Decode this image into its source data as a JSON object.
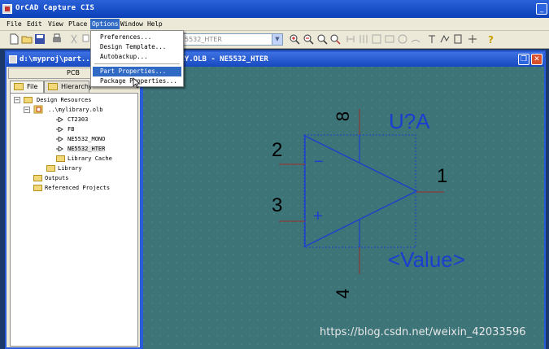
{
  "app": {
    "title": "OrCAD Capture CIS",
    "window_buttons": [
      "_"
    ]
  },
  "menubar": {
    "items": [
      "File",
      "Edit",
      "View",
      "Place",
      "Options",
      "Window",
      "Help"
    ],
    "active": "Options"
  },
  "toolbar": {
    "part_combo_value": "5532_HTER"
  },
  "options_menu": {
    "items": [
      "Preferences...",
      "Design Template...",
      "Autobackup...",
      "Part Properties...",
      "Package Properties..."
    ],
    "highlighted": "Part Properties..."
  },
  "project_window": {
    "title": "d:\\myproj\\part..",
    "pcb_label": "PCB",
    "tabs": [
      "File",
      "Hierarchy"
    ],
    "tree": [
      {
        "label": "Design Resources",
        "level": 0
      },
      {
        "label": "..\\mylibrary.olb",
        "level": 1
      },
      {
        "label": "CT2303",
        "level": 2
      },
      {
        "label": "FB",
        "level": 2
      },
      {
        "label": "NE5532_MONO",
        "level": 2
      },
      {
        "label": "NE5532_HTER",
        "level": 2
      },
      {
        "label": "Library Cache",
        "level": 2
      },
      {
        "label": "Library",
        "level": 1
      },
      {
        "label": "Outputs",
        "level": 0
      },
      {
        "label": "Referenced Projects",
        "level": 0
      }
    ]
  },
  "schematic_window": {
    "title": "ARY.OLB - NE5532_HTER"
  },
  "schematic": {
    "ref_designator": "U?A",
    "value": "<Value>",
    "pins": {
      "top": "8",
      "inv_input": "2",
      "noninv_input": "3",
      "output": "1",
      "bottom": "4"
    },
    "minus_sign": "−",
    "plus_sign": "+"
  },
  "watermark": "https://blog.csdn.net/weixin_42033596",
  "colors": {
    "canvas": "#3d7478",
    "part_blue": "#1a3fd0",
    "pin_red": "#8b3a3a",
    "titlebar": "#0a3fb8",
    "menu_highlight": "#316ac5"
  }
}
